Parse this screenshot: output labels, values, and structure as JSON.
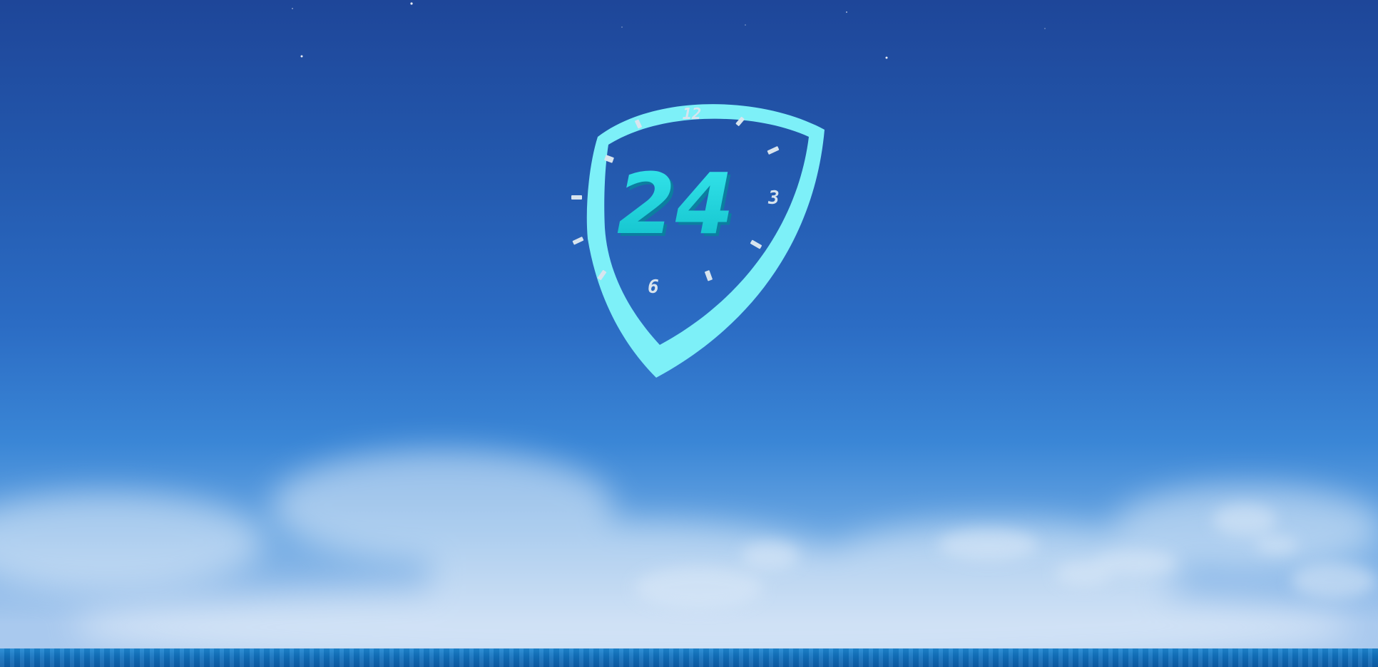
{
  "emblem": {
    "number": "24",
    "dial_labels": {
      "twelve": "12",
      "three": "3",
      "six": "6"
    },
    "icon": "shield-clock-icon",
    "colors": {
      "shield": "#7df0f8",
      "number": "#18d6dc",
      "ticks": "#d8e4ee"
    }
  },
  "scene": {
    "colors": {
      "sky_top": "#1e4699",
      "sky_horizon": "#a9c9ee",
      "sea": "#1170bd"
    }
  }
}
